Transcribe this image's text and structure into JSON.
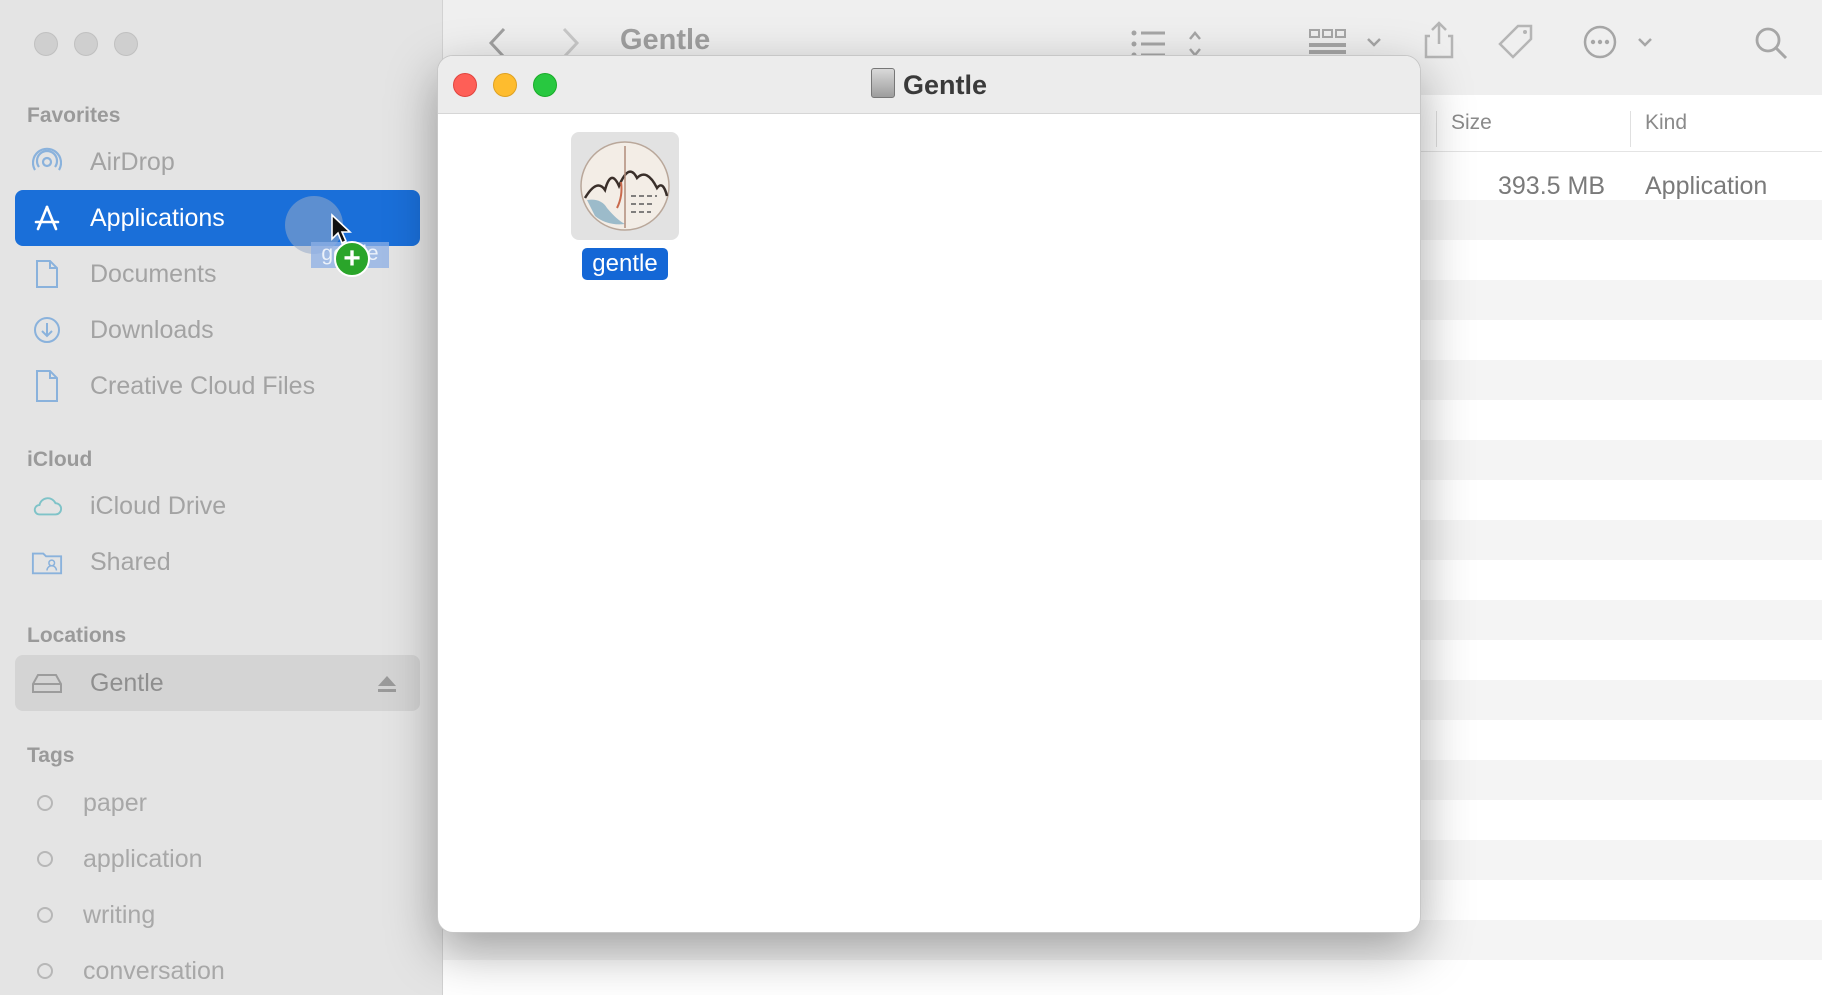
{
  "sidebar": {
    "favorites_title": "Favorites",
    "favorites": [
      {
        "label": "AirDrop",
        "icon": "airdrop-icon"
      },
      {
        "label": "Applications",
        "icon": "applications-icon",
        "active": true
      },
      {
        "label": "Documents",
        "icon": "document-icon"
      },
      {
        "label": "Downloads",
        "icon": "download-icon"
      },
      {
        "label": "Creative Cloud Files",
        "icon": "document-icon"
      }
    ],
    "icloud_title": "iCloud",
    "icloud": [
      {
        "label": "iCloud Drive",
        "icon": "cloud-icon"
      },
      {
        "label": "Shared",
        "icon": "shared-folder-icon"
      }
    ],
    "locations_title": "Locations",
    "locations": [
      {
        "label": "Gentle",
        "icon": "drive-icon"
      }
    ],
    "tags_title": "Tags",
    "tags": [
      "paper",
      "application",
      "writing",
      "conversation"
    ]
  },
  "toolbar": {
    "title": "Gentle"
  },
  "list": {
    "columns": {
      "size": "Size",
      "kind": "Kind"
    },
    "rows": [
      {
        "size": "393.5 MB",
        "kind": "Application"
      }
    ]
  },
  "drag": {
    "ghost_label": "gentle"
  },
  "dmg_window": {
    "title": "Gentle",
    "item_label": "gentle"
  },
  "colors": {
    "accent": "#1a6fd9",
    "close": "#fe5f57",
    "minimize": "#febc2e",
    "zoom": "#28c840",
    "drop_badge": "#2aa52a"
  }
}
